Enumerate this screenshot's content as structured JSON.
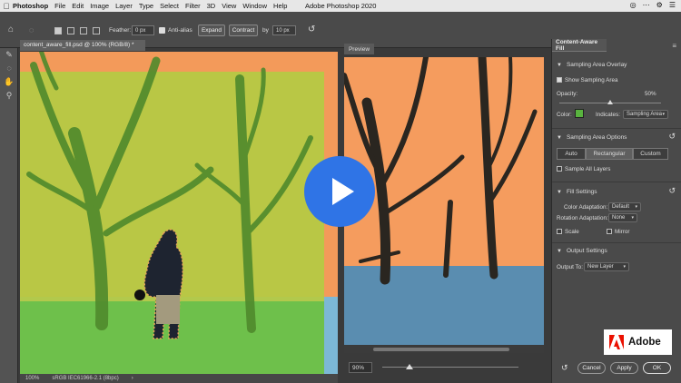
{
  "menubar": {
    "app": "Photoshop",
    "items": [
      "File",
      "Edit",
      "Image",
      "Layer",
      "Type",
      "Select",
      "Filter",
      "3D",
      "View",
      "Window",
      "Help"
    ],
    "title": "Adobe Photoshop 2020"
  },
  "options": {
    "feather_label": "Feather:",
    "feather_value": "0 px",
    "antialias_label": "Anti-alias",
    "expand_label": "Expand",
    "contract_label": "Contract",
    "by_label": "by",
    "by_value": "10 px"
  },
  "document": {
    "tab_title": "content_aware_fill.psd @ 100% (RGB/8) *",
    "zoom": "100%",
    "profile": "sRGB IEC61966-2.1 (8bpc)"
  },
  "preview": {
    "tab": "Preview",
    "zoom": "90%",
    "zoom_fraction": 0.2
  },
  "panel": {
    "tab": "Content-Aware Fill",
    "sampling_overlay": {
      "title": "Sampling Area Overlay",
      "show_label": "Show Sampling Area",
      "opacity_label": "Opacity:",
      "opacity_value": "50%",
      "opacity_fraction": 0.5,
      "color_label": "Color:",
      "color": "#59b33f",
      "indicates_label": "Indicates:",
      "indicates_value": "Sampling Area"
    },
    "sampling_options": {
      "title": "Sampling Area Options",
      "modes": [
        "Auto",
        "Rectangular",
        "Custom"
      ],
      "active_mode": "Rectangular",
      "all_layers_label": "Sample All Layers"
    },
    "fill_settings": {
      "title": "Fill Settings",
      "color_adaptation_label": "Color Adaptation:",
      "color_adaptation_value": "Default",
      "rotation_adaptation_label": "Rotation Adaptation:",
      "rotation_adaptation_value": "None",
      "scale_label": "Scale",
      "mirror_label": "Mirror"
    },
    "output_settings": {
      "title": "Output Settings",
      "output_to_label": "Output To:",
      "output_to_value": "New Layer"
    },
    "buttons": {
      "cancel": "Cancel",
      "apply": "Apply",
      "ok": "OK"
    }
  },
  "brand": {
    "name": "Adobe",
    "color": "#eb1000"
  },
  "colors": {
    "sky": "#f59c5e",
    "overlay": "#5fb03a",
    "accent": "#2f74e6"
  }
}
